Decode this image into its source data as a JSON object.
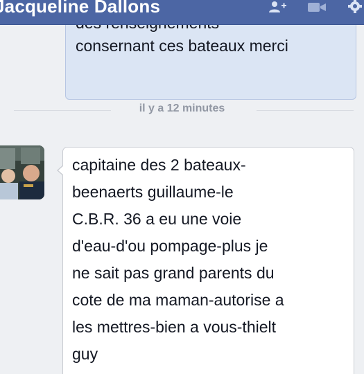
{
  "header": {
    "contact_name": "Jacqueline Dallons",
    "icons": [
      "add-user-icon",
      "video-camera-icon",
      "gear-icon"
    ],
    "color": "#4c66a4"
  },
  "conversation": {
    "outgoing_message": {
      "lines": [
        "des renseignements",
        "consernant ces bateaux merci"
      ]
    },
    "timestamp": "il y a 12 minutes",
    "incoming_message": {
      "lines": [
        "capitaine des 2 bateaux-",
        "beenaerts guillaume-le",
        "C.B.R. 36 a eu une voie",
        "d'eau-d'ou pompage-plus je",
        "ne sait pas grand parents du",
        "cote de ma maman-autorise a",
        "les mettres-bien a vous-thielt",
        "guy"
      ]
    }
  }
}
